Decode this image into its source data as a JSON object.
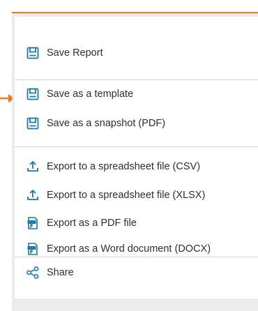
{
  "colors": {
    "accent": "#ec7a1f",
    "icon": "#1b7aa8",
    "text": "#2e2e2e",
    "menu_bg": "#ececec",
    "separator": "#d6d6d6"
  },
  "menu": {
    "sections": [
      {
        "items": [
          {
            "label": "Save Report",
            "icon": "save-icon"
          }
        ]
      },
      {
        "items": [
          {
            "label": "Save as a template",
            "icon": "save-icon"
          },
          {
            "label": "Save as a snapshot (PDF)",
            "icon": "save-icon"
          }
        ]
      },
      {
        "items": [
          {
            "label": "Export to a spreadsheet file (CSV)",
            "icon": "upload-icon"
          },
          {
            "label": "Export to a spreadsheet file (XLSX)",
            "icon": "upload-icon"
          },
          {
            "label": "Export as a PDF file",
            "icon": "pdf-file-icon"
          },
          {
            "label": "Export as a Word document (DOCX)",
            "icon": "doc-file-icon"
          }
        ]
      },
      {
        "items": [
          {
            "label": "Share",
            "icon": "share-icon"
          }
        ]
      }
    ]
  }
}
